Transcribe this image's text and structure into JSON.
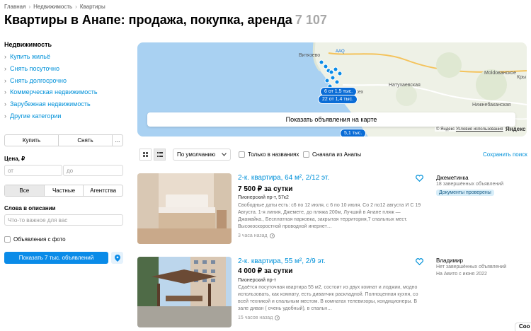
{
  "breadcrumbs": [
    "Главная",
    "Недвижимость",
    "Квартиры"
  ],
  "breadcrumb_sep": "›",
  "title": "Квартиры в Анапе: продажа, покупка, аренда",
  "title_count": "7 107",
  "categories": {
    "heading": "Недвижимость",
    "items": [
      "Купить жильё",
      "Снять посуточно",
      "Снять долгосрочно",
      "Коммерческая недвижимость",
      "Зарубежная недвижимость",
      "Другие категории"
    ]
  },
  "deal_type": {
    "options": [
      "Купить",
      "Снять",
      "..."
    ]
  },
  "price": {
    "label": "Цена, ₽",
    "from_placeholder": "от",
    "to_placeholder": "до"
  },
  "seller_type": {
    "options": [
      "Все",
      "Частные",
      "Агентства"
    ],
    "selected": "Все"
  },
  "description_words": {
    "label": "Слова в описании",
    "placeholder": "Что-то важное для вас"
  },
  "with_photo_label": "Объявления с фото",
  "show_button": "Показать 7 тыс. объявлений",
  "map": {
    "show_on_map": "Показать объявления на карте",
    "places": [
      "Витязево",
      "Моldованское",
      "Натухаевская",
      "Нижнебаканская",
      "Кры",
      "Супсех",
      "ААQ"
    ],
    "clusters": [
      "6 от 1,5 тыс.",
      "22 от 1,4 тыс.",
      "5,1 тыс."
    ],
    "copyright": "© Яндекс",
    "terms": "Условия использования",
    "brand": "Яндекс"
  },
  "toolbar": {
    "sort": "По умолчанию",
    "only_titles": "Только в названиях",
    "first_anapa": "Сначала из Анапы",
    "save_search": "Сохранить поиск"
  },
  "listings": [
    {
      "title": "2-к. квартира, 64 м², 2/12 эт.",
      "price": "7 500 ₽ за сутки",
      "address": "Пионерский пр-т, 57к2",
      "desc": "Свободные даты есть: с6 по 12 июля, с 6 по 10 июля. Со 2 по12 августа И С 19 Августа. 1-я линия, Джемете, до пляжа 200м, Лучший в Анапе пляж — Джамайка., Бесплатная парковка, закрытая территория,7 спальных мест. Высокоскоростной проводной инернет…",
      "time": "3 часа назад",
      "seller_name": "Джеметинка",
      "seller_sub": "18 завершённых объявлений",
      "badge": "Документы проверены"
    },
    {
      "title": "2-к. квартира, 55 м², 2/9 эт.",
      "price": "4 000 ₽ за сутки",
      "address": "Пионерский пр-т",
      "desc": "Сдаётся посуточная квартира 55 м2, состоит из двух комнат и лоджии, модно использовать, как комнату, есть диванчик раскладной. Полноценная кухня, со всей техникой и спальным местом. В комнатах телевизоры, кондиционеры. В зале диван ( очень удобный), в спальн…",
      "time": "15 часов назад",
      "seller_name": "Владимир",
      "seller_sub": "Нет завершённых объявлений",
      "seller_sub2": "На Авито с июня 2022"
    }
  ],
  "chat_label": "Соо"
}
